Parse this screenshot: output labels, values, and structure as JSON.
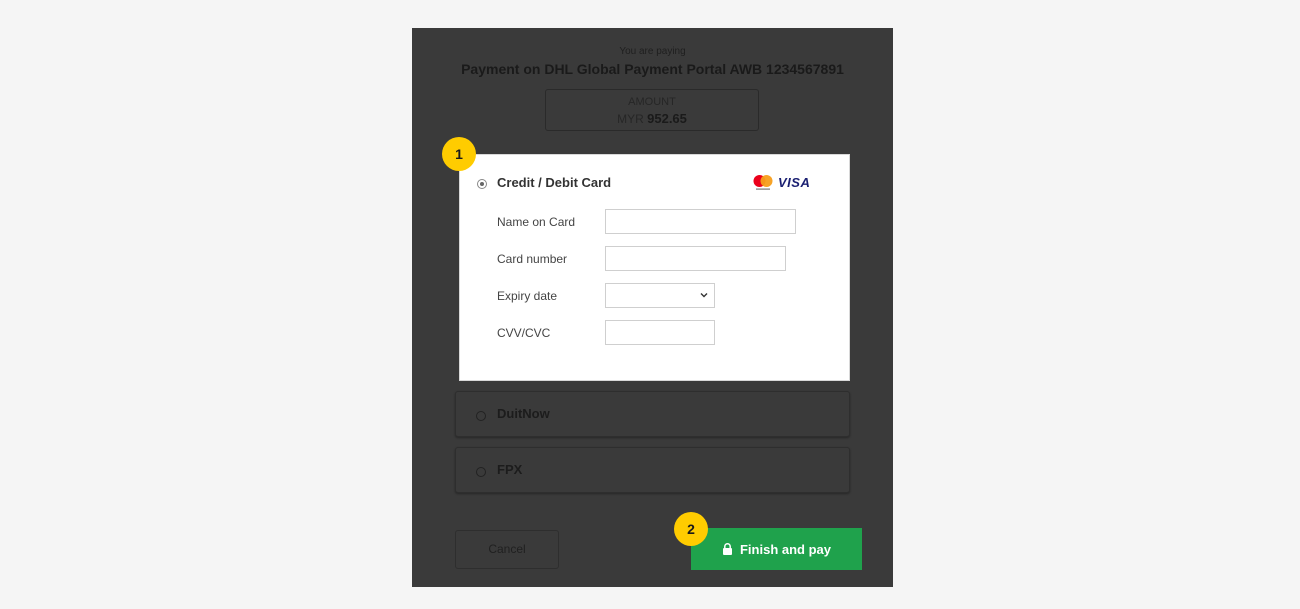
{
  "header": {
    "paying_label": "You are paying",
    "title": "Payment on DHL Global Payment Portal AWB 1234567891"
  },
  "amount": {
    "label": "AMOUNT",
    "currency": "MYR",
    "value": "952.65"
  },
  "card_method": {
    "label": "Credit / Debit Card",
    "selected": true,
    "brands": [
      "mastercard-icon",
      "VISA"
    ],
    "fields": {
      "name_label": "Name on Card",
      "name_value": "",
      "number_label": "Card number",
      "number_value": "",
      "expiry_label": "Expiry date",
      "expiry_value": "",
      "cvv_label": "CVV/CVC",
      "cvv_value": ""
    }
  },
  "other_methods": [
    {
      "label": "DuitNow",
      "selected": false
    },
    {
      "label": "FPX",
      "selected": false
    }
  ],
  "actions": {
    "cancel_label": "Cancel",
    "pay_label": "Finish and pay"
  },
  "steps": [
    "1",
    "2"
  ],
  "colors": {
    "overlay": "#3a3a3a",
    "pay_button": "#1fa24c",
    "step_badge": "#ffcc00",
    "visa_blue": "#1a1f71",
    "mastercard_red": "#eb001b",
    "mastercard_orange": "#f79e1b"
  }
}
